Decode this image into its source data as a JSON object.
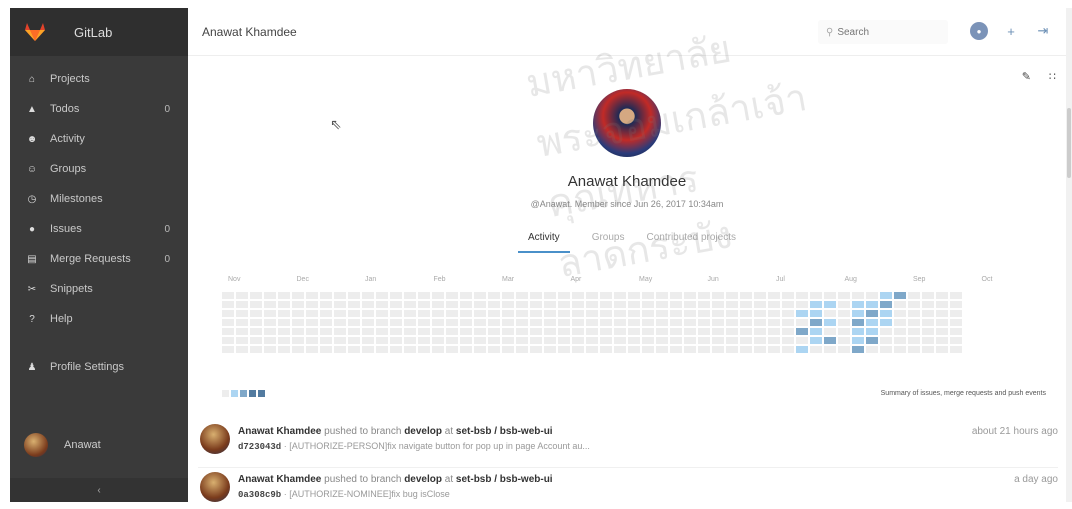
{
  "sidebar": {
    "brand": "GitLab",
    "items": [
      {
        "label": "Projects",
        "icon": "home-icon",
        "glyph": "⌂",
        "count": ""
      },
      {
        "label": "Todos",
        "icon": "bell-icon",
        "glyph": "▲",
        "count": "0"
      },
      {
        "label": "Activity",
        "icon": "activity-icon",
        "glyph": "☻",
        "count": ""
      },
      {
        "label": "Groups",
        "icon": "groups-icon",
        "glyph": "☺",
        "count": ""
      },
      {
        "label": "Milestones",
        "icon": "clock-icon",
        "glyph": "◷",
        "count": ""
      },
      {
        "label": "Issues",
        "icon": "info-icon",
        "glyph": "●",
        "count": "0"
      },
      {
        "label": "Merge Requests",
        "icon": "merge-request-icon",
        "glyph": "▤",
        "count": "0"
      },
      {
        "label": "Snippets",
        "icon": "snippet-icon",
        "glyph": "✂",
        "count": ""
      },
      {
        "label": "Help",
        "icon": "help-icon",
        "glyph": "?",
        "count": ""
      }
    ],
    "profile_settings": {
      "label": "Profile Settings",
      "icon": "person-icon",
      "glyph": "♟"
    },
    "user_name": "Anawat",
    "collapse_glyph": "‹"
  },
  "topbar": {
    "title": "Anawat Khamdee",
    "search_placeholder": "Search",
    "icons": [
      {
        "name": "user-avatar-icon",
        "glyph": "●"
      },
      {
        "name": "plus-icon",
        "glyph": "+"
      },
      {
        "name": "sign-out-icon",
        "glyph": "⇥"
      }
    ]
  },
  "profile": {
    "name": "Anawat Khamdee",
    "meta": "@Anawat. Member since Jun 26, 2017 10:34am",
    "edit_glyph": "✎",
    "rss_glyph": "∷"
  },
  "tabs": [
    {
      "label": "Activity",
      "active": true
    },
    {
      "label": "Groups",
      "active": false
    },
    {
      "label": "Contributed projects",
      "active": false
    }
  ],
  "calendar": {
    "months": [
      "Nov",
      "Dec",
      "Jan",
      "Feb",
      "Mar",
      "Apr",
      "May",
      "Jun",
      "Jul",
      "Aug",
      "Sep",
      "Oct"
    ],
    "summary": "Summary of issues, merge requests and push events",
    "colors": {
      "empty": "#ededed",
      "l1": "#acd5f2",
      "l2": "#7fa8c9",
      "l3": "#527ba0"
    },
    "active_weeks": {
      "41": [
        2,
        4,
        6
      ],
      "42": [
        1,
        2,
        3,
        4,
        5
      ],
      "43": [
        1,
        3,
        5
      ],
      "45": [
        1,
        2,
        3,
        4,
        5,
        6
      ],
      "46": [
        1,
        2,
        3,
        4,
        5
      ],
      "47": [
        0,
        1,
        2,
        3
      ],
      "48": [
        0
      ]
    }
  },
  "events": [
    {
      "author": "Anawat Khamdee",
      "action": "pushed to branch",
      "branch": "develop",
      "at": "at",
      "project": "set-bsb / bsb-web-ui",
      "sha": "d723043d",
      "message": "· [AUTHORIZE-PERSON]fix navigate button for pop up in page Account au...",
      "time": "about 21 hours ago"
    },
    {
      "author": "Anawat Khamdee",
      "action": "pushed to branch",
      "branch": "develop",
      "at": "at",
      "project": "set-bsb / bsb-web-ui",
      "sha": "0a308c9b",
      "message": "· [AUTHORIZE-NOMINEE]fix bug isClose",
      "time": "a day ago"
    }
  ],
  "watermark": "มหาวิทยาลัยพระจอมเกล้าเจ้าคุณทหารลาดกระบัง"
}
